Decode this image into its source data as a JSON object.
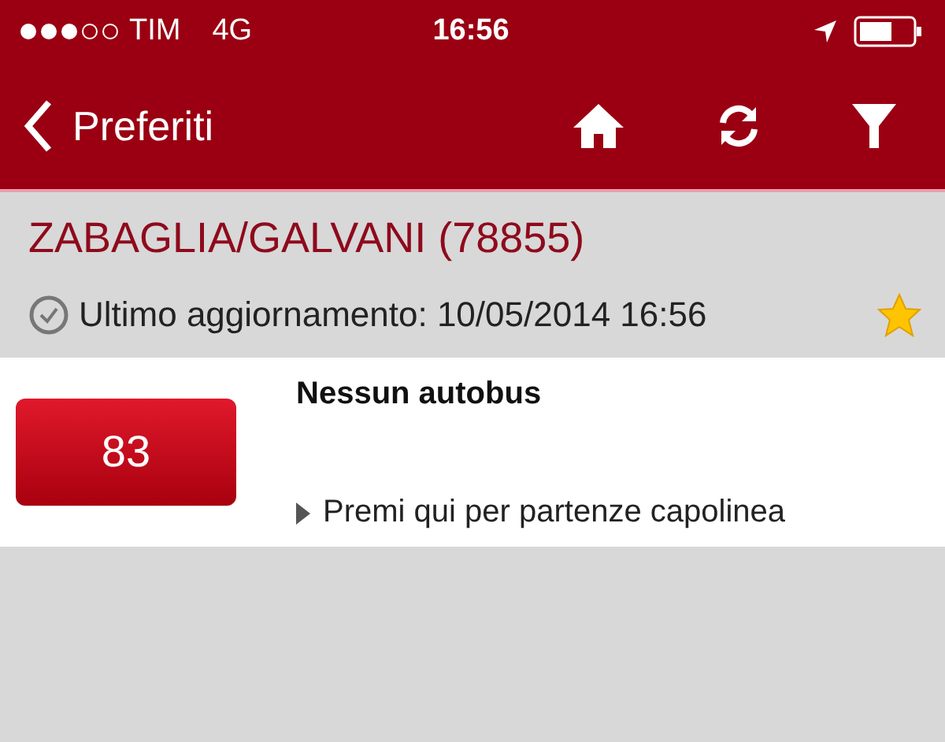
{
  "status_bar": {
    "carrier": "TIM",
    "network": "4G",
    "time": "16:56"
  },
  "nav_bar": {
    "back_label": "Preferiti"
  },
  "stop": {
    "title": "ZABAGLIA/GALVANI (78855)",
    "updated": "Ultimo aggiornamento: 10/05/2014 16:56",
    "favorite": true
  },
  "lines": [
    {
      "number": "83",
      "status": "Nessun autobus",
      "link": "Premi qui per partenze capolinea"
    }
  ]
}
